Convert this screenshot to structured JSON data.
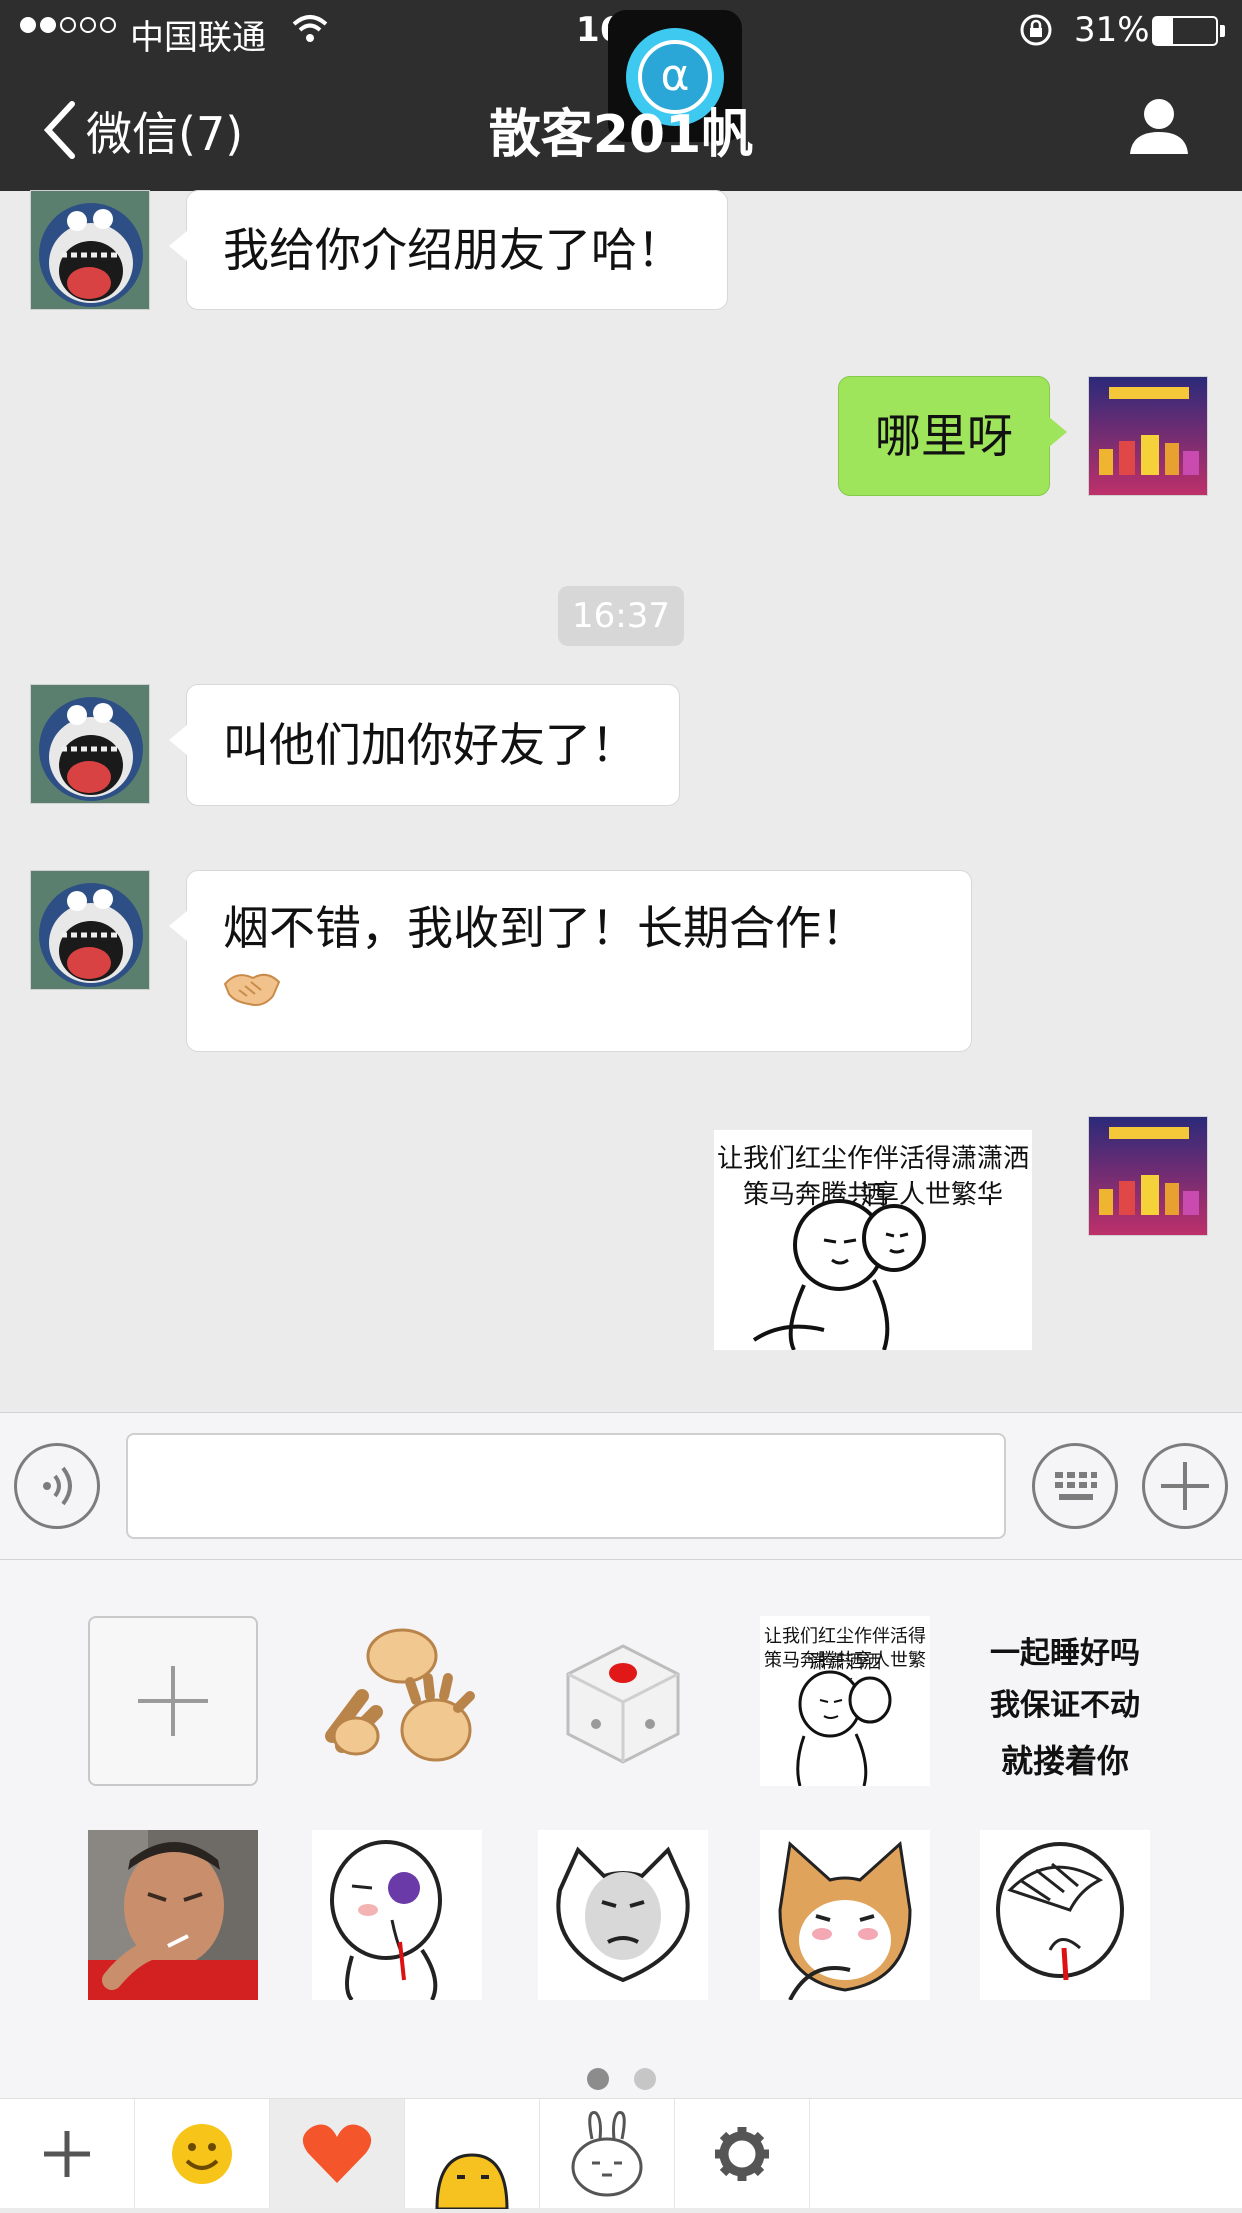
{
  "status_bar": {
    "carrier": "中国联通",
    "time": "16:38",
    "battery": "31%"
  },
  "nav": {
    "back_label": "微信(7)",
    "title": "散客201帆"
  },
  "messages": [
    {
      "side": "left",
      "text": "我给你介绍朋友了哈！"
    },
    {
      "side": "right",
      "text": "哪里呀"
    },
    {
      "type": "timestamp",
      "text": "16:37"
    },
    {
      "side": "left",
      "text": "叫他们加你好友了！"
    },
    {
      "side": "left",
      "text": "烟不错，我收到了！长期合作！"
    },
    {
      "side": "right",
      "type": "sticker",
      "text_line1": "让我们红尘作伴活得潇潇洒洒",
      "text_line2": "策马奔腾共享人世繁华"
    }
  ],
  "sticker_panel": {
    "meme_text": "让我们红尘作伴活得潇潇洒洒",
    "meme_text2": "策马奔腾共享人世繁华",
    "text_sticker": [
      "一起睡好吗",
      "我保证不动",
      "就搂着你"
    ],
    "pages": 2,
    "current_page": 1
  },
  "colors": {
    "nav_bg": "#2e2e2e",
    "chat_bg": "#ebebeb",
    "bubble_mine": "#9fe55c",
    "bubble_other": "#ffffff"
  },
  "icons": [
    "back-chevron-icon",
    "profile-icon",
    "voice-icon",
    "keyboard-icon",
    "plus-icon",
    "emoji-icon",
    "heart-icon",
    "egg-icon",
    "rabbit-icon",
    "settings-icon"
  ]
}
